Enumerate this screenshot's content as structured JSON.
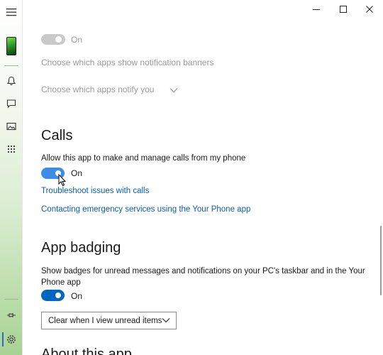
{
  "titlebar": {
    "minimize_icon": "minimize-icon",
    "maximize_icon": "maximize-icon",
    "close_icon": "close-icon"
  },
  "rail": {
    "items": [
      "hamburger-icon",
      "phone-thumbnail",
      "notifications-icon",
      "messages-icon",
      "photos-icon",
      "apps-grid-icon",
      "pin-icon",
      "settings-icon"
    ]
  },
  "notifications": {
    "banner_toggle_label": "On",
    "choose_banners": "Choose which apps show notification banners",
    "choose_notify": "Choose which apps notify you"
  },
  "calls": {
    "title": "Calls",
    "description": "Allow this app to make and manage calls from my phone",
    "toggle_label": "On",
    "troubleshoot_link": "Troubleshoot issues with calls",
    "emergency_link": "Contacting emergency services using the Your Phone app"
  },
  "app_badging": {
    "title": "App badging",
    "description": "Show badges for unread messages and notifications on your PC's taskbar and in the Your Phone app",
    "toggle_label": "On",
    "select_value": "Clear when I view unread items"
  },
  "next_section": {
    "title": "About this app"
  },
  "colors": {
    "accent": "#0067c0",
    "link": "#0b5cad",
    "dim_text": "#9a9a9a"
  }
}
